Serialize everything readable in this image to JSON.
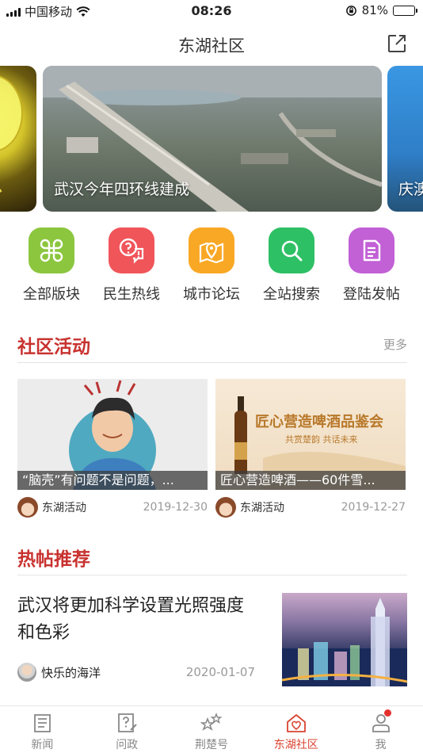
{
  "status_bar": {
    "carrier": "中国移动",
    "time": "08:26",
    "battery": "81%",
    "battery_level": 0.81
  },
  "navbar": {
    "title": "东湖社区"
  },
  "banner": {
    "slides": [
      {
        "caption": ""
      },
      {
        "caption": "武汉今年四环线建成"
      },
      {
        "caption": "庆澳"
      }
    ]
  },
  "quick_links": [
    {
      "label": "全部版块",
      "icon": "grid-icon",
      "color": "#8cc63f"
    },
    {
      "label": "民生热线",
      "icon": "hotline-chat-icon",
      "color": "#f0555a"
    },
    {
      "label": "城市论坛",
      "icon": "map-pin-icon",
      "color": "#f9a825"
    },
    {
      "label": "全站搜索",
      "icon": "search-icon",
      "color": "#2ec065"
    },
    {
      "label": "登陆发帖",
      "icon": "document-icon",
      "color": "#c260d6"
    }
  ],
  "activities": {
    "heading": "社区活动",
    "more": "更多",
    "items": [
      {
        "caption": "“脑壳”有问题不是问题，...",
        "author": "东湖活动",
        "date": "2019-12-30"
      },
      {
        "caption": "匠心营造啤酒——60件雪...",
        "author": "东湖活动",
        "date": "2019-12-27",
        "image_title": "匠心营造啤酒品鉴会",
        "image_subtitle": "共赏楚韵  共话未来"
      }
    ]
  },
  "hot_posts": {
    "heading": "热帖推荐",
    "items": [
      {
        "title": "武汉将更加科学设置光照强度和色彩",
        "author": "快乐的海洋",
        "date": "2020-01-07"
      }
    ]
  },
  "tabbar": {
    "tabs": [
      {
        "label": "新闻",
        "icon": "news-icon"
      },
      {
        "label": "问政",
        "icon": "question-icon"
      },
      {
        "label": "荆楚号",
        "icon": "stars-icon"
      },
      {
        "label": "东湖社区",
        "icon": "community-home-icon",
        "active": true
      },
      {
        "label": "我",
        "icon": "profile-icon",
        "badge": true
      }
    ],
    "active_color": "#d9442f"
  }
}
